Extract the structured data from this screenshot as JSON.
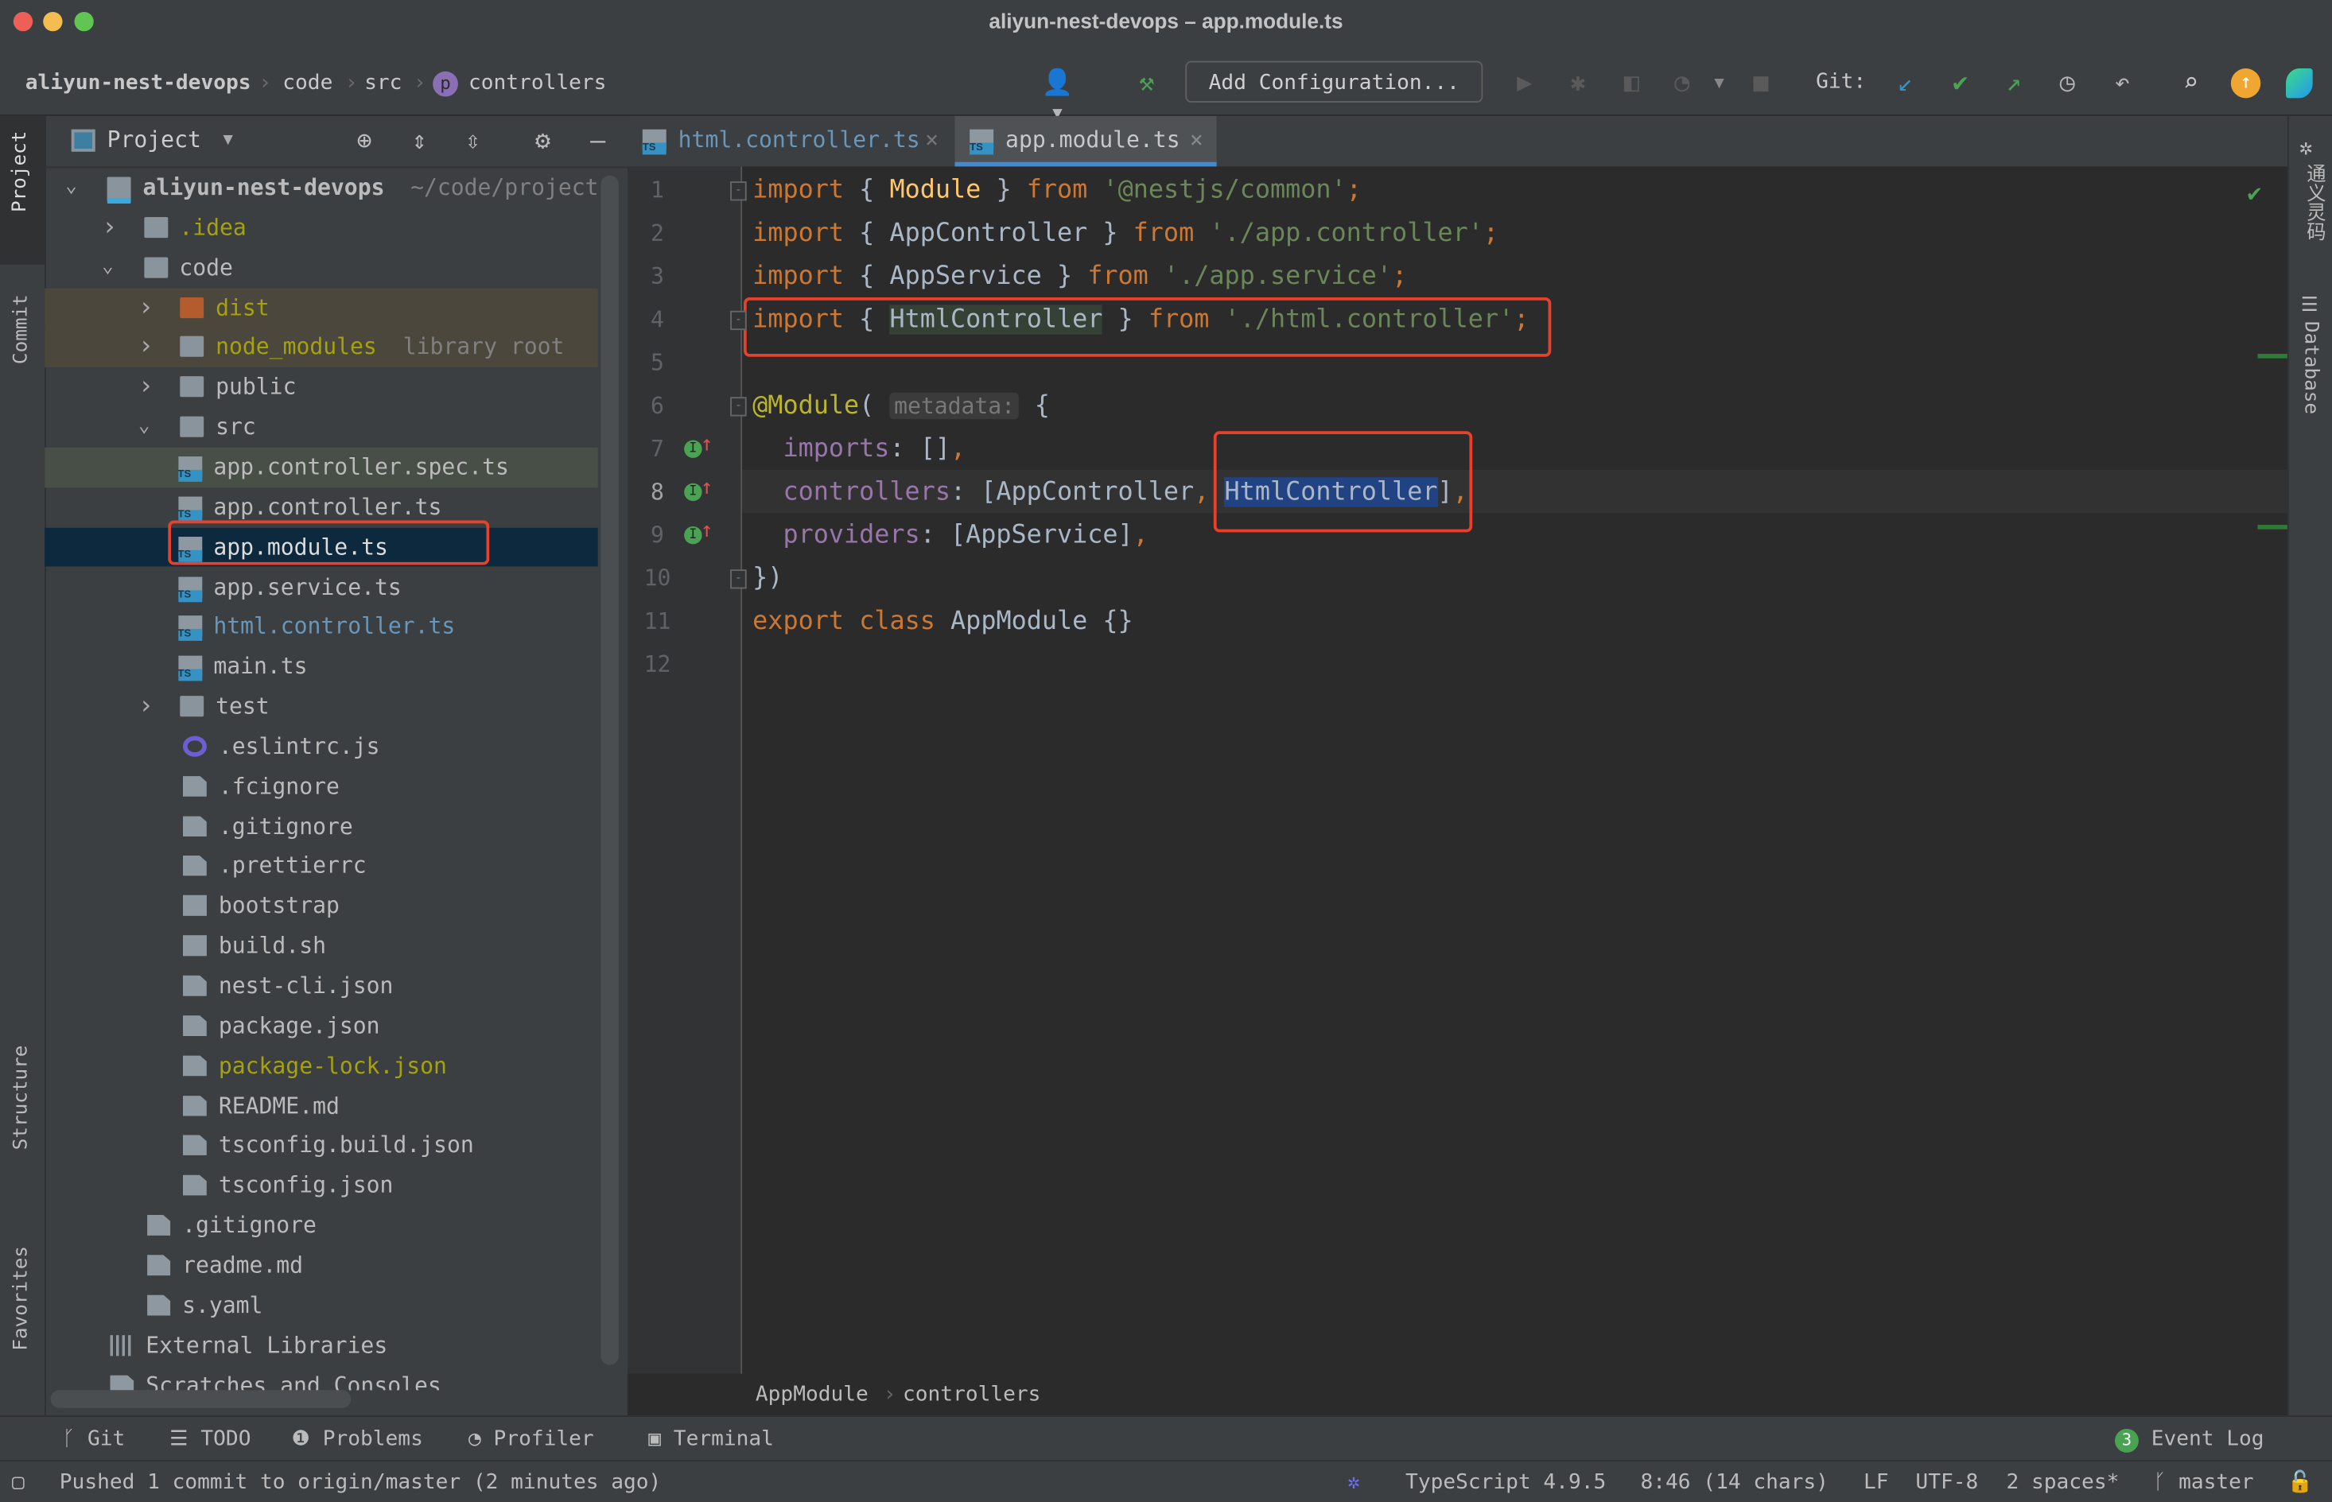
{
  "window": {
    "title": "aliyun-nest-devops – app.module.ts"
  },
  "breadcrumb": [
    "aliyun-nest-devops",
    "code",
    "src",
    "controllers"
  ],
  "toolbar": {
    "add_configuration": "Add Configuration...",
    "git_label": "Git:"
  },
  "colors": {
    "accent": "#4a88c7",
    "annotation": "#e8402a",
    "selection": "#214283",
    "editor_bg": "#2b2b2b",
    "panel_bg": "#3c3f41"
  },
  "left_stripe": {
    "project": "Project",
    "commit": "Commit",
    "structure": "Structure",
    "favorites": "Favorites"
  },
  "right_stripe": {
    "tongyi": "通义灵码",
    "database": "Database"
  },
  "project_panel": {
    "title": "Project",
    "tree": [
      {
        "label": "aliyun-nest-devops",
        "hint": "~/code/project-",
        "level": 0,
        "kind": "module",
        "expanded": true,
        "bold": true
      },
      {
        "label": ".idea",
        "level": 1,
        "kind": "folder",
        "expanded": false,
        "color": "#a5a20c"
      },
      {
        "label": "code",
        "level": 1,
        "kind": "folder",
        "expanded": true
      },
      {
        "label": "dist",
        "level": 2,
        "kind": "folder-excluded",
        "expanded": false,
        "color": "#a5a20c",
        "bg": "#4c473d"
      },
      {
        "label": "node_modules",
        "hint": "library root",
        "level": 2,
        "kind": "folder",
        "expanded": false,
        "color": "#a5a20c",
        "bg": "#4c473d"
      },
      {
        "label": "public",
        "level": 2,
        "kind": "folder",
        "expanded": false
      },
      {
        "label": "src",
        "level": 2,
        "kind": "folder",
        "expanded": true
      },
      {
        "label": "app.controller.spec.ts",
        "level": 3,
        "kind": "ts",
        "bg": "#474f47"
      },
      {
        "label": "app.controller.ts",
        "level": 3,
        "kind": "ts"
      },
      {
        "label": "app.module.ts",
        "level": 3,
        "kind": "ts",
        "selected": true
      },
      {
        "label": "app.service.ts",
        "level": 3,
        "kind": "ts"
      },
      {
        "label": "html.controller.ts",
        "level": 3,
        "kind": "ts",
        "color": "#6897bb"
      },
      {
        "label": "main.ts",
        "level": 3,
        "kind": "ts"
      },
      {
        "label": "test",
        "level": 2,
        "kind": "folder",
        "expanded": false
      },
      {
        "label": ".eslintrc.js",
        "level": 2,
        "kind": "eslint"
      },
      {
        "label": ".fcignore",
        "level": 2,
        "kind": "file"
      },
      {
        "label": ".gitignore",
        "level": 2,
        "kind": "file"
      },
      {
        "label": ".prettierrc",
        "level": 2,
        "kind": "file"
      },
      {
        "label": "bootstrap",
        "level": 2,
        "kind": "exec"
      },
      {
        "label": "build.sh",
        "level": 2,
        "kind": "exec"
      },
      {
        "label": "nest-cli.json",
        "level": 2,
        "kind": "file"
      },
      {
        "label": "package.json",
        "level": 2,
        "kind": "file"
      },
      {
        "label": "package-lock.json",
        "level": 2,
        "kind": "file",
        "color": "#a5a20c"
      },
      {
        "label": "README.md",
        "level": 2,
        "kind": "file"
      },
      {
        "label": "tsconfig.build.json",
        "level": 2,
        "kind": "file"
      },
      {
        "label": "tsconfig.json",
        "level": 2,
        "kind": "file"
      },
      {
        "label": ".gitignore",
        "level": 1,
        "kind": "file"
      },
      {
        "label": "readme.md",
        "level": 1,
        "kind": "file"
      },
      {
        "label": "s.yaml",
        "level": 1,
        "kind": "file"
      },
      {
        "label": "External Libraries",
        "level": 0,
        "kind": "libs"
      },
      {
        "label": "Scratches and Consoles",
        "level": 0,
        "kind": "scratch"
      }
    ]
  },
  "tabs": [
    {
      "label": "html.controller.ts",
      "active": false
    },
    {
      "label": "app.module.ts",
      "active": true
    }
  ],
  "editor": {
    "current_line": 8,
    "lines": [
      [
        [
          "import",
          "kw"
        ],
        [
          " { ",
          "plain"
        ],
        [
          "Module",
          "cls"
        ],
        [
          " } ",
          "plain"
        ],
        [
          "from",
          "kw"
        ],
        [
          " ",
          "plain"
        ],
        [
          "'@nestjs/common'",
          "str"
        ],
        [
          ";",
          "kw"
        ]
      ],
      [
        [
          "import",
          "kw"
        ],
        [
          " { AppController } ",
          "plain"
        ],
        [
          "from",
          "kw"
        ],
        [
          " ",
          "plain"
        ],
        [
          "'./app.controller'",
          "str"
        ],
        [
          ";",
          "kw"
        ]
      ],
      [
        [
          "import",
          "kw"
        ],
        [
          " { AppService } ",
          "plain"
        ],
        [
          "from",
          "kw"
        ],
        [
          " ",
          "plain"
        ],
        [
          "'./app.service'",
          "str"
        ],
        [
          ";",
          "kw"
        ]
      ],
      [
        [
          "import",
          "kw"
        ],
        [
          " { ",
          "plain"
        ],
        [
          "HtmlController",
          "usage"
        ],
        [
          " } ",
          "plain"
        ],
        [
          "from",
          "kw"
        ],
        [
          " ",
          "plain"
        ],
        [
          "'./html.controller'",
          "str"
        ],
        [
          ";",
          "kw"
        ]
      ],
      [],
      [
        [
          "@Module",
          "dec"
        ],
        [
          "( ",
          "plain"
        ],
        [
          "metadata:",
          "hint"
        ],
        [
          " {",
          "plain"
        ]
      ],
      [
        [
          "  imports",
          "prop"
        ],
        [
          ": []",
          "plain"
        ],
        [
          ",",
          "kw"
        ]
      ],
      [
        [
          "  controllers",
          "prop"
        ],
        [
          ": [AppController",
          "plain"
        ],
        [
          ",",
          "kw"
        ],
        [
          " ",
          "plain"
        ],
        [
          "HtmlController",
          "sel"
        ],
        [
          "]",
          "plain"
        ],
        [
          ",",
          "kw"
        ]
      ],
      [
        [
          "  providers",
          "prop"
        ],
        [
          ": [AppService]",
          "plain"
        ],
        [
          ",",
          "kw"
        ]
      ],
      [
        [
          "})",
          "plain"
        ]
      ],
      [
        [
          "export",
          "kw"
        ],
        [
          " ",
          "plain"
        ],
        [
          "class",
          "kw"
        ],
        [
          " AppModule {}",
          "plain"
        ]
      ],
      []
    ],
    "breadcrumb": [
      "AppModule",
      "controllers"
    ]
  },
  "tool_windows": {
    "left": [
      "Git",
      "TODO",
      "Problems",
      "Profiler",
      "Terminal"
    ],
    "event_log": "Event Log",
    "event_count": "3"
  },
  "status_bar": {
    "message": "Pushed 1 commit to origin/master (2 minutes ago)",
    "language": "TypeScript 4.9.5",
    "position": "8:46 (14 chars)",
    "line_sep": "LF",
    "encoding": "UTF-8",
    "indent": "2 spaces*",
    "branch": "master"
  }
}
